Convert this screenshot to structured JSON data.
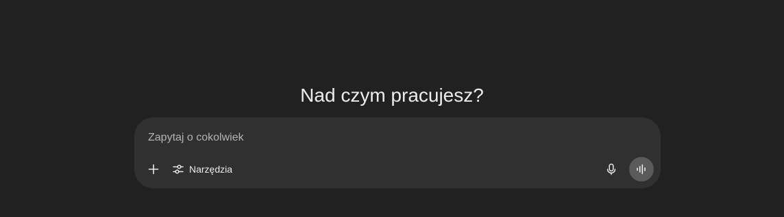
{
  "main": {
    "heading": "Nad czym pracujesz?"
  },
  "composer": {
    "placeholder": "Zapytaj o cokolwiek",
    "value": "",
    "plus_icon": "plus-icon",
    "tools_icon": "sliders-icon",
    "tools_label": "Narzędzia",
    "mic_icon": "microphone-icon",
    "voice_icon": "voice-waveform-icon"
  },
  "colors": {
    "background": "#212121",
    "composer_background": "#303030",
    "text": "#ececec",
    "placeholder": "#b4b4b4",
    "voice_button": "#5a5a5a"
  }
}
